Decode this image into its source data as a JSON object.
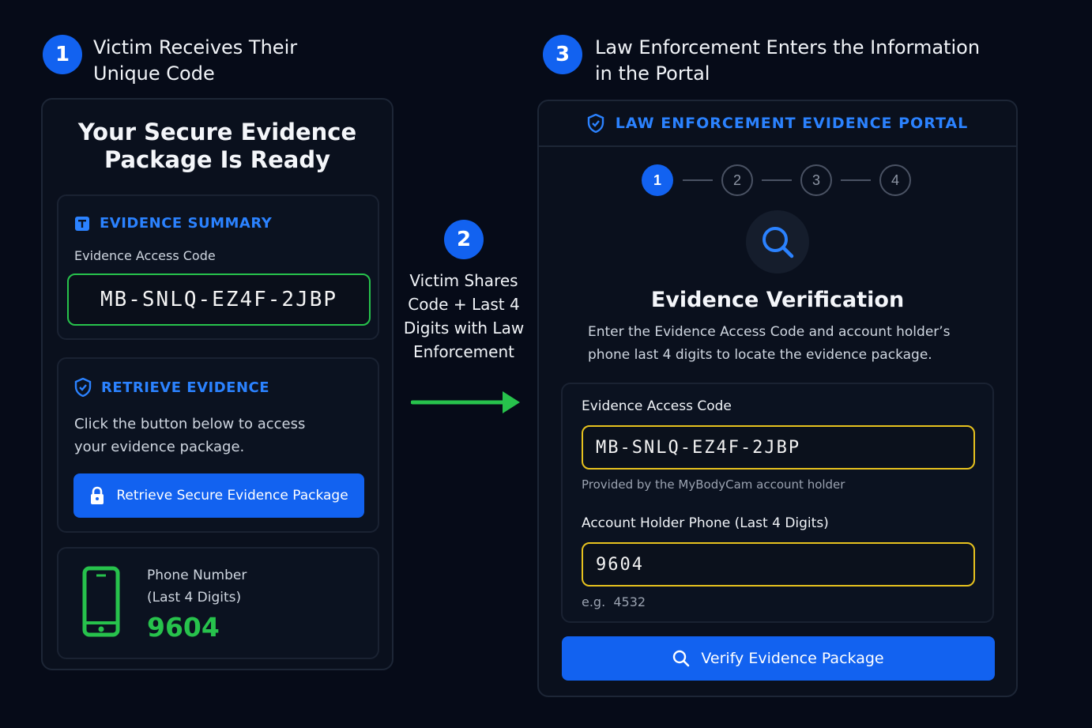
{
  "step1": {
    "number": "1",
    "title_line1": "Victim Receives Their",
    "title_line2": "Unique Code"
  },
  "step2": {
    "number": "2",
    "line1": "Victim Shares",
    "line2": "Code + Last 4",
    "line3": "Digits with Law",
    "line4": "Enforcement"
  },
  "step3": {
    "number": "3",
    "title_line1": "Law Enforcement Enters the Information",
    "title_line2": "in the Portal"
  },
  "left_card": {
    "title_line1": "Your Secure Evidence",
    "title_line2": "Package Is Ready",
    "summary": {
      "heading": "EVIDENCE SUMMARY",
      "label": "Evidence Access Code",
      "code": "MB-SNLQ-EZ4F-2JBP"
    },
    "retrieve": {
      "heading": "RETRIEVE EVIDENCE",
      "text_line1": "Click the button below to access",
      "text_line2": "your evidence package.",
      "button_label": "Retrieve Secure Evidence Package"
    },
    "phone": {
      "label_line1": "Phone Number",
      "label_line2": "(Last 4 Digits)",
      "value": "9604"
    }
  },
  "portal": {
    "header": "LAW ENFORCEMENT EVIDENCE PORTAL",
    "steps": [
      "1",
      "2",
      "3",
      "4"
    ],
    "active_step": 1,
    "title": "Evidence Verification",
    "desc_line1": "Enter the Evidence Access Code and account holder’s",
    "desc_line2": "phone last 4 digits to locate the evidence package.",
    "code_label": "Evidence Access Code",
    "code_value": "MB-SNLQ-EZ4F-2JBP",
    "code_hint": "Provided by the MyBodyCam account holder",
    "phone_label": "Account Holder Phone (Last 4 Digits)",
    "phone_value": "9604",
    "phone_hint": "e.g.  4532",
    "verify_label": "Verify Evidence Package"
  },
  "colors": {
    "accent": "#1262f0",
    "heading_blue": "#2b82ff",
    "success_green": "#27c24c",
    "input_yellow": "#e7c21e",
    "background": "#060b18"
  }
}
